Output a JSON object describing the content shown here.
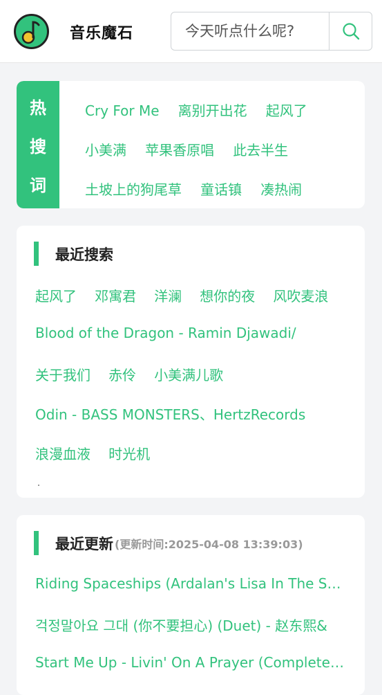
{
  "header": {
    "app_name": "音乐魔石",
    "search_placeholder": "今天听点什么呢?",
    "search_icon": "search-icon",
    "logo_icon": "music-note-logo"
  },
  "hot_search": {
    "badge_chars": [
      "热",
      "搜",
      "词"
    ],
    "rows": [
      [
        "Cry For Me",
        "离别开出花",
        "起风了"
      ],
      [
        "小美满",
        "苹果香原唱",
        "此去半生"
      ],
      [
        "土坡上的狗尾草",
        "童话镇",
        "凑热闹"
      ]
    ]
  },
  "recent_search": {
    "title": "最近搜索",
    "rows": [
      [
        "起风了",
        "邓寓君",
        "洋澜",
        "想你的夜",
        "风吹麦浪"
      ],
      [
        "Blood of the Dragon - Ramin Djawadi/"
      ],
      [
        "关于我们",
        "赤伶",
        "小美满儿歌"
      ],
      [
        "Odin - BASS MONSTERS、HertzRecords"
      ],
      [
        "浪漫血液",
        "时光机"
      ]
    ]
  },
  "recent_updates": {
    "title": "最近更新",
    "update_time": "(更新时间:2025-04-08 13:39:03)",
    "items": [
      "Riding Spaceships (Ardalan's Lisa In The Sky Remix)",
      "걱정말아요 그대 (你不要担心) (Duet) - 赵东熙&",
      "Start Me Up - Livin' On A Prayer (Complete version)"
    ]
  },
  "colors": {
    "accent": "#32c27d",
    "background": "#f3f4f6"
  }
}
